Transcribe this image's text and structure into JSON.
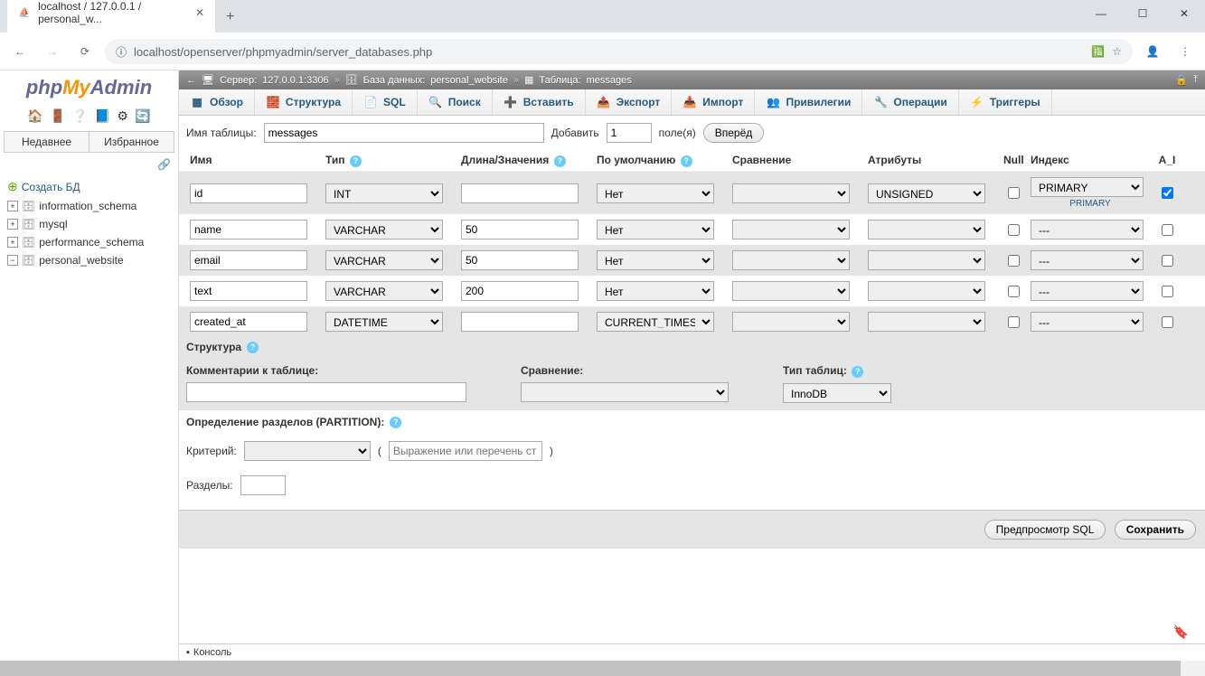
{
  "browser": {
    "tab_title": "localhost / 127.0.0.1 / personal_w...",
    "url": "localhost/openserver/phpmyadmin/server_databases.php"
  },
  "logo": {
    "php": "php",
    "my": "My",
    "admin": "Admin"
  },
  "panel_tabs": {
    "recent": "Недавнее",
    "fav": "Избранное"
  },
  "tree": {
    "new_db": "Создать БД",
    "items": [
      "information_schema",
      "mysql",
      "performance_schema",
      "personal_website"
    ]
  },
  "breadcrumb": {
    "server_label": "Сервер:",
    "server_val": "127.0.0.1:3306",
    "db_label": "База данных:",
    "db_val": "personal_website",
    "tbl_label": "Таблица:",
    "tbl_val": "messages"
  },
  "topmenu": [
    "Обзор",
    "Структура",
    "SQL",
    "Поиск",
    "Вставить",
    "Экспорт",
    "Импорт",
    "Привилегии",
    "Операции",
    "Триггеры"
  ],
  "tbl_form": {
    "name_label": "Имя таблицы:",
    "name_val": "messages",
    "add_label": "Добавить",
    "add_val": "1",
    "fields_label": "поле(я)",
    "go": "Вперёд"
  },
  "headers": {
    "name": "Имя",
    "type": "Тип",
    "len": "Длина/Значения",
    "def": "По умолчанию",
    "coll": "Сравнение",
    "attr": "Атрибуты",
    "null": "Null",
    "idx": "Индекс",
    "ai": "A_I"
  },
  "rows": [
    {
      "name": "id",
      "type": "INT",
      "len": "",
      "def": "Нет",
      "coll": "",
      "attr": "UNSIGNED",
      "null": false,
      "idx": "PRIMARY",
      "idx_sub": "PRIMARY",
      "ai": true
    },
    {
      "name": "name",
      "type": "VARCHAR",
      "len": "50",
      "def": "Нет",
      "coll": "",
      "attr": "",
      "null": false,
      "idx": "---",
      "ai": false
    },
    {
      "name": "email",
      "type": "VARCHAR",
      "len": "50",
      "def": "Нет",
      "coll": "",
      "attr": "",
      "null": false,
      "idx": "---",
      "ai": false
    },
    {
      "name": "text",
      "type": "VARCHAR",
      "len": "200",
      "def": "Нет",
      "coll": "",
      "attr": "",
      "null": false,
      "idx": "---",
      "ai": false
    },
    {
      "name": "created_at",
      "type": "DATETIME",
      "len": "",
      "def": "CURRENT_TIMESTAMP",
      "coll": "",
      "attr": "",
      "null": false,
      "idx": "---",
      "ai": false
    }
  ],
  "structure": {
    "header": "Структура",
    "comments": "Комментарии к таблице:",
    "collation": "Сравнение:",
    "engine": "Тип таблиц:",
    "engine_val": "InnoDB"
  },
  "partition": {
    "header": "Определение разделов (PARTITION):",
    "crit": "Критерий:",
    "expr_ph": "Выражение или перечень ст",
    "parts": "Разделы:"
  },
  "footer": {
    "preview": "Предпросмотр SQL",
    "save": "Сохранить"
  },
  "console": "Консоль"
}
